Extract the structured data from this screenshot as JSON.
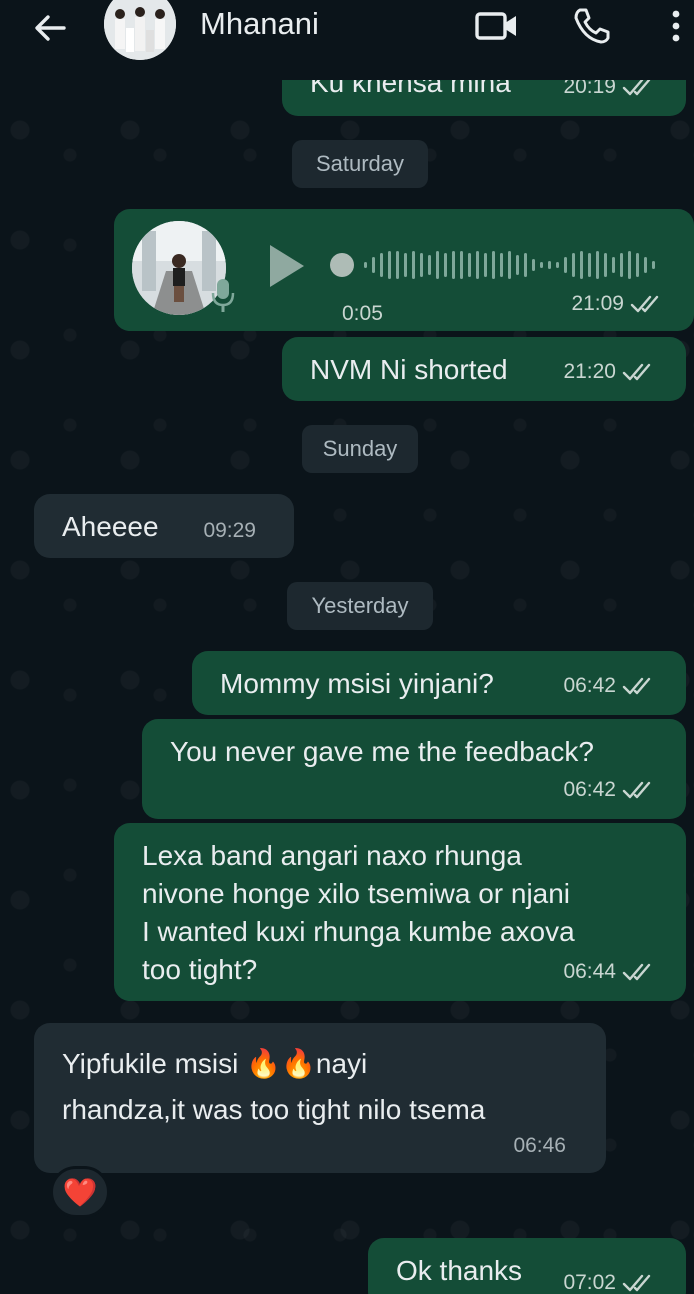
{
  "header": {
    "contact_name": "Mhanani",
    "back_icon": "arrow-left-icon",
    "video_icon": "video-call-icon",
    "call_icon": "phone-icon",
    "menu_icon": "more-vert-icon"
  },
  "messages": {
    "m0": {
      "text": "Ku khensa mina",
      "time": "20:19"
    },
    "day1": "Saturday",
    "voice": {
      "duration": "0:05",
      "time": "21:09"
    },
    "m1": {
      "text": "NVM Ni shorted",
      "time": "21:20"
    },
    "day2": "Sunday",
    "m2": {
      "text": "Aheeee",
      "time": "09:29"
    },
    "day3": "Yesterday",
    "m3": {
      "text": "Mommy msisi yinjani?",
      "time": "06:42"
    },
    "m4": {
      "text": "You never gave me the feedback?",
      "time": "06:42"
    },
    "m5": {
      "line1": "Lexa band angari naxo rhunga",
      "line2": "nivone honge xilo tsemiwa or njani",
      "line3": "I wanted kuxi rhunga kumbe axova",
      "line4": "too tight?",
      "time": "06:44"
    },
    "m6": {
      "part1": "Yipfukile msisi ",
      "emoji1": "🔥",
      "emoji2": "🔥",
      "part2": "nayi",
      "line2": "rhandza,it was too tight nilo tsema",
      "time": "06:46"
    },
    "reaction": "❤️",
    "m7": {
      "text": "Ok thanks",
      "time": "07:02"
    }
  },
  "colors": {
    "background": "#0b141a",
    "outgoing_bubble": "#144d37",
    "incoming_bubble": "#202c33",
    "read_ticks": "#c9d6d1"
  }
}
